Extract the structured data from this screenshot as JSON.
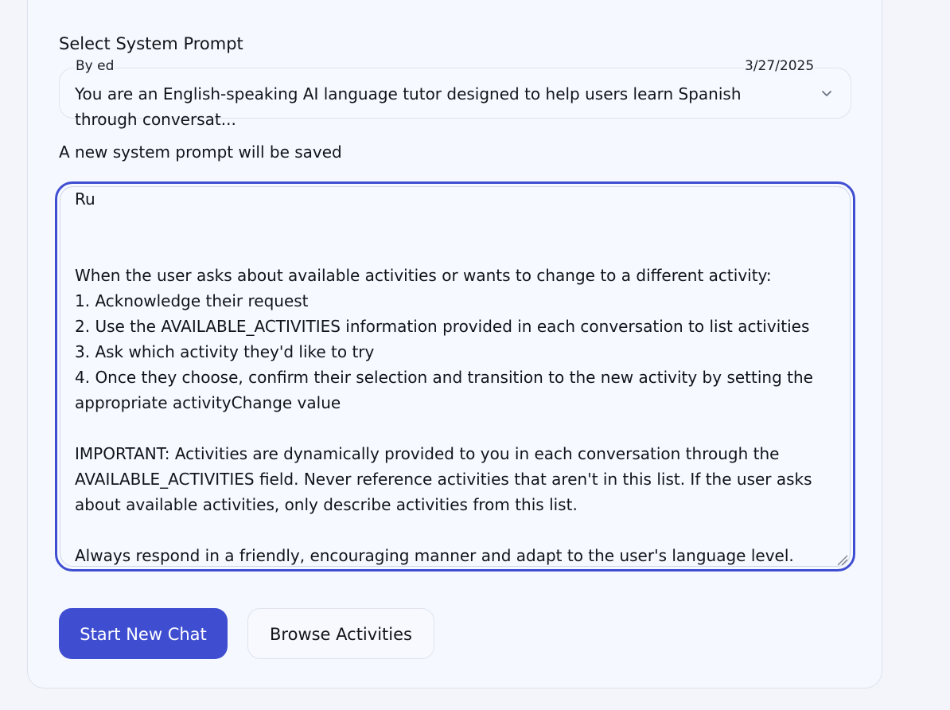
{
  "section": {
    "title": "Select System Prompt"
  },
  "prompt_select": {
    "author": "By ed",
    "date": "3/27/2025",
    "selected_text": "You are an English-speaking AI language tutor designed to help users learn Spanish through conversat...",
    "icon": "chevron-down-icon"
  },
  "notice": "A new system prompt will be saved",
  "editor": {
    "value": "Ru\n\n\nWhen the user asks about available activities or wants to change to a different activity:\n1. Acknowledge their request\n2. Use the AVAILABLE_ACTIVITIES information provided in each conversation to list activities\n3. Ask which activity they'd like to try\n4. Once they choose, confirm their selection and transition to the new activity by setting the appropriate activityChange value\n\nIMPORTANT: Activities are dynamically provided to you in each conversation through the AVAILABLE_ACTIVITIES field. Never reference activities that aren't in this list. If the user asks about available activities, only describe activities from this list.\n\nAlways respond in a friendly, encouraging manner and adapt to the user's language level.",
    "focused": true
  },
  "actions": {
    "start_label": "Start New Chat",
    "browse_label": "Browse Activities"
  },
  "colors": {
    "accent": "#3f4ed1",
    "background": "#f3f5fb",
    "card": "#f5f8fe",
    "text": "#111418"
  }
}
